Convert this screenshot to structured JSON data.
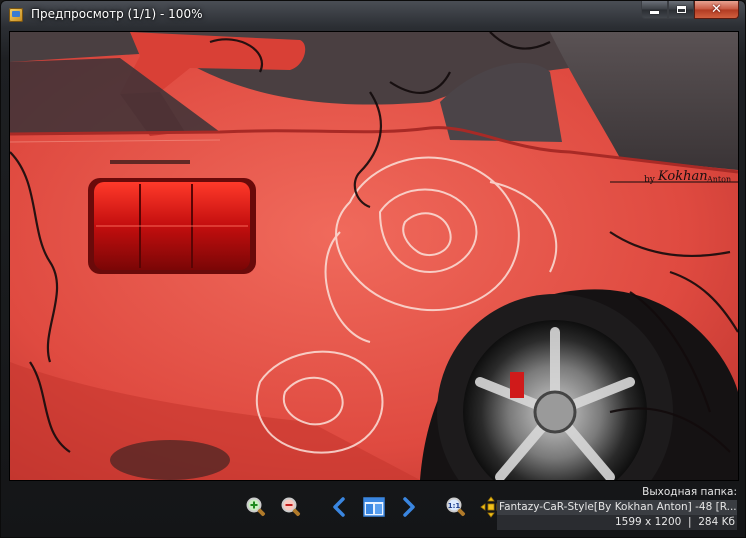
{
  "window": {
    "title": "Предпросмотр (1/1) - 100%",
    "close_glyph": "✕"
  },
  "image": {
    "description_alt": "Фото красного автомобиля",
    "watermark_by": "by",
    "watermark_name": "Kokhan",
    "watermark_suffix": "Anton"
  },
  "toolbar": {
    "zoom_in_icon": "zoom-in-icon",
    "zoom_out_icon": "zoom-out-icon",
    "prev_icon": "arrow-left-icon",
    "layout_icon": "panel-layout-icon",
    "next_icon": "arrow-right-icon",
    "actual_size_icon": "zoom-actual-size-icon",
    "fit_icon": "fit-to-window-icon",
    "actual_size_label": "1:1"
  },
  "info": {
    "output_folder_label": "Выходная папка:",
    "file_name": "Fantazy-CaR-Style[By Kokhan Anton] -48 [R...",
    "dimensions": "1599 x 1200",
    "separator": "|",
    "file_size": "284 Kб"
  },
  "colors": {
    "accent": "#3a86e0",
    "close_button": "#c7563f",
    "car_paint": "#e2443b"
  }
}
